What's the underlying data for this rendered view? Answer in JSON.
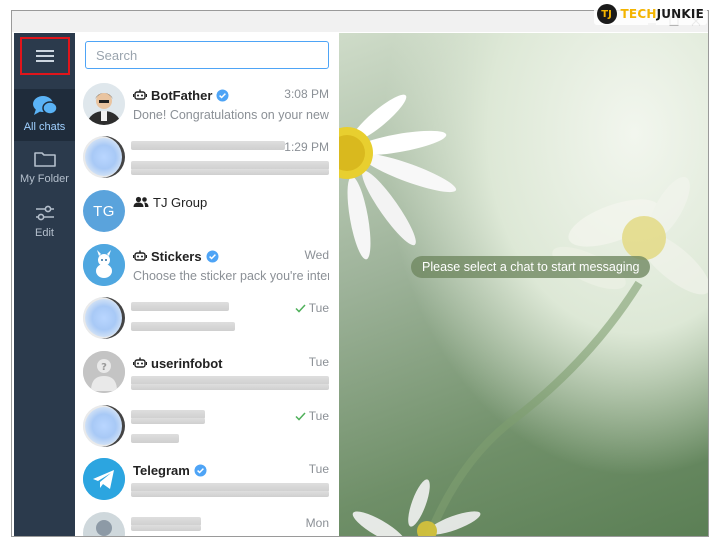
{
  "watermark": {
    "tech": "TECH",
    "junkie": "JUNKIE",
    "logo": "TJ"
  },
  "search": {
    "placeholder": "Search",
    "value": ""
  },
  "rail": {
    "items": [
      {
        "label": "All chats",
        "icon": "chats-icon",
        "active": true
      },
      {
        "label": "My Folder",
        "icon": "folder-icon",
        "active": false
      },
      {
        "label": "Edit",
        "icon": "sliders-icon",
        "active": false
      }
    ]
  },
  "chats": [
    {
      "name": "BotFather",
      "kind": "bot",
      "verified": true,
      "time": "3:08 PM",
      "preview": "Done! Congratulations on your new..."
    },
    {
      "name": "",
      "time": "1:29 PM",
      "preview": ""
    },
    {
      "name": "TJ Group",
      "kind": "group",
      "initials": "TG",
      "time": "",
      "preview": ""
    },
    {
      "name": "Stickers",
      "kind": "bot",
      "verified": true,
      "time": "Wed",
      "preview": "Choose the sticker pack you're inter..."
    },
    {
      "name": "",
      "time": "Tue",
      "read": true,
      "preview": ""
    },
    {
      "name": "userinfobot",
      "kind": "bot",
      "time": "Tue",
      "preview": ""
    },
    {
      "name": "",
      "time": "Tue",
      "read": true,
      "preview": ""
    },
    {
      "name": "Telegram",
      "verified": true,
      "time": "Tue",
      "preview": ""
    },
    {
      "name": "",
      "time": "Mon",
      "preview": ""
    }
  ],
  "main": {
    "hint": "Please select a chat to start messaging"
  },
  "colors": {
    "accent": "#4ea4f6",
    "rail": "#2b3a4c",
    "highlight": "#e0151b",
    "verified": "#4ea4f6"
  }
}
